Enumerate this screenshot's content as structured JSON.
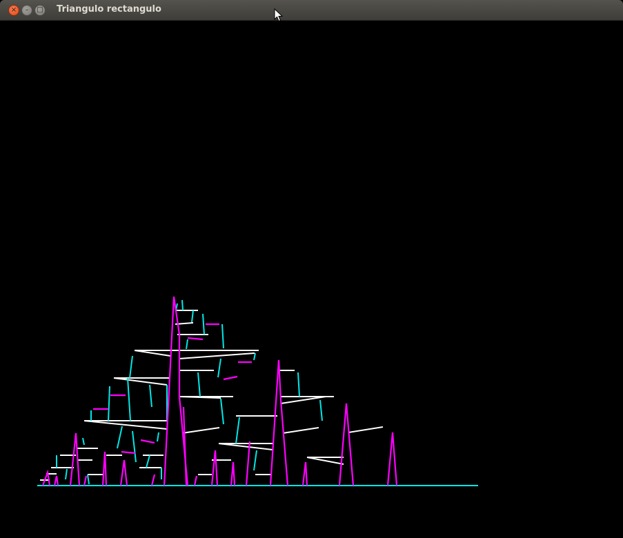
{
  "window": {
    "title": "Triangulo rectangulo",
    "controls": {
      "close_glyph": "×",
      "minimize_glyph": "–",
      "maximize_glyph": "□"
    }
  },
  "canvas": {
    "background": "#000000",
    "colors": {
      "base": "#00e0e0",
      "vertical": "#ff00ff",
      "horizontal": "#ffffff",
      "small": "#00e8e8"
    }
  }
}
